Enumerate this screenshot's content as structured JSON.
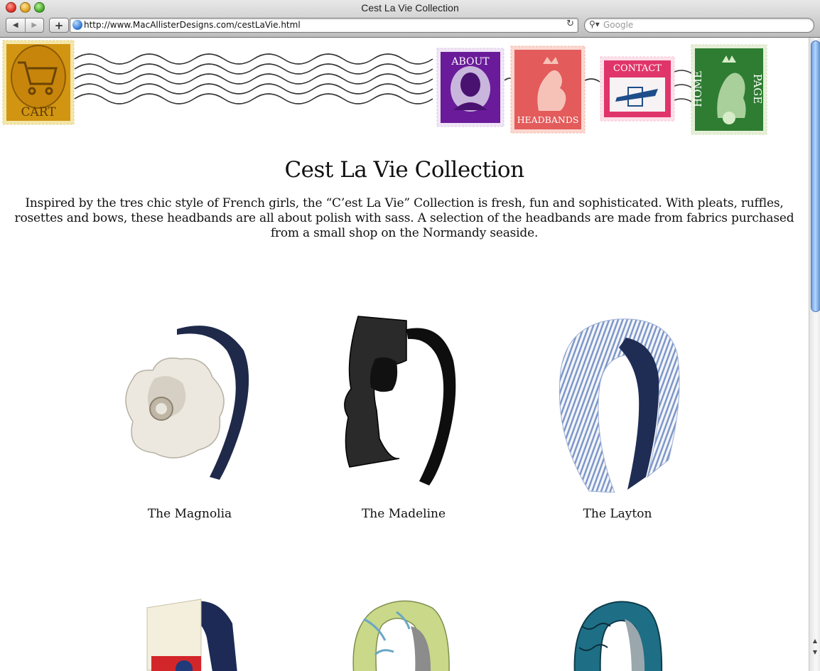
{
  "window": {
    "title": "Cest La Vie Collection"
  },
  "browser": {
    "url": "http://www.MacAllisterDesigns.com/cestLaVie.html",
    "search_placeholder": "Google",
    "back_icon": "◀",
    "forward_icon": "▶",
    "add_icon": "+",
    "reload_icon": "↻"
  },
  "nav_stamps": [
    {
      "label": "CART",
      "color": "#d29512"
    },
    {
      "label": "ABOUT",
      "color": "#6a1b9a"
    },
    {
      "label": "HEADBANDS",
      "color": "#e35b5b"
    },
    {
      "label": "CONTACT",
      "color": "#e0356a"
    },
    {
      "label_top": "HOME",
      "label_bottom": "PAGE",
      "color": "#2e7d32"
    }
  ],
  "page": {
    "title": "Cest La Vie Collection",
    "intro": "Inspired by the tres chic style of French girls, the “C’est La Vie” Collection is fresh, fun and sophisticated. With pleats, ruffles, rosettes and bows, these headbands are all about polish with sass. A selection of the headbands are made from fabrics purchased from a small shop on the Normandy seaside."
  },
  "products": [
    {
      "name": "The Magnolia"
    },
    {
      "name": "The Madeline"
    },
    {
      "name": "The Layton"
    }
  ]
}
